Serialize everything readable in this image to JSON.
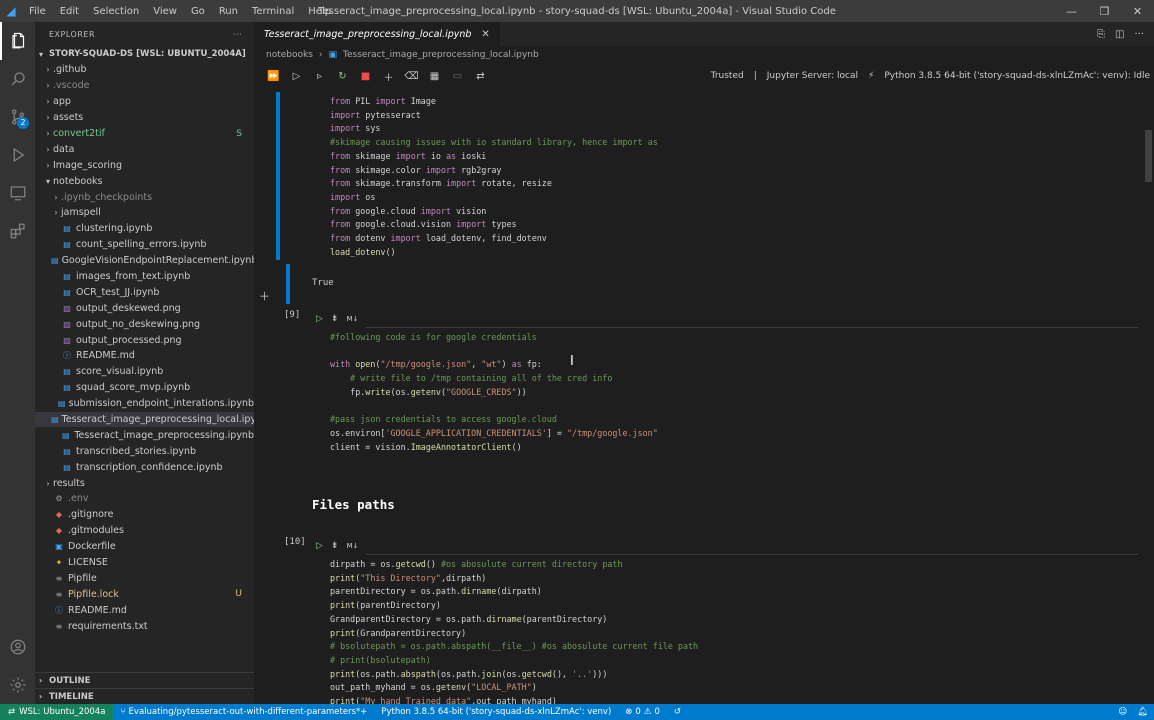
{
  "titlebar": {
    "menu": [
      "File",
      "Edit",
      "Selection",
      "View",
      "Go",
      "Run",
      "Terminal",
      "Help"
    ],
    "title": "Tesseract_image_preprocessing_local.ipynb - story-squad-ds [WSL: Ubuntu_2004a] - Visual Studio Code"
  },
  "activitybar": {
    "source_control_badge": "2"
  },
  "sidebar": {
    "header": "EXPLORER",
    "workspace": "STORY-SQUAD-DS [WSL: UBUNTU_2004A]",
    "items": [
      {
        "label": ".github",
        "type": "folder",
        "depth": 1,
        "color": "#cccccc"
      },
      {
        "label": ".vscode",
        "type": "folder",
        "depth": 1,
        "color": "#8b8b8b"
      },
      {
        "label": "app",
        "type": "folder",
        "depth": 1,
        "color": "#cccccc"
      },
      {
        "label": "assets",
        "type": "folder",
        "depth": 1,
        "color": "#cccccc"
      },
      {
        "label": "convert2tif",
        "type": "folder",
        "depth": 1,
        "color": "#73c991",
        "deco": "S"
      },
      {
        "label": "data",
        "type": "folder",
        "depth": 1,
        "color": "#cccccc"
      },
      {
        "label": "Image_scoring",
        "type": "folder",
        "depth": 1,
        "color": "#cccccc"
      },
      {
        "label": "notebooks",
        "type": "folder-open",
        "depth": 1,
        "color": "#cccccc"
      },
      {
        "label": ".ipynb_checkpoints",
        "type": "folder",
        "depth": 2,
        "color": "#8b8b8b"
      },
      {
        "label": "jamspell",
        "type": "folder",
        "depth": 2,
        "color": "#cccccc"
      },
      {
        "label": "clustering.ipynb",
        "type": "nb",
        "depth": 2,
        "color": "#cccccc"
      },
      {
        "label": "count_spelling_errors.ipynb",
        "type": "nb",
        "depth": 2,
        "color": "#cccccc"
      },
      {
        "label": "GoogleVisionEndpointReplacement.ipynb",
        "type": "nb",
        "depth": 2,
        "color": "#cccccc"
      },
      {
        "label": "images_from_text.ipynb",
        "type": "nb",
        "depth": 2,
        "color": "#cccccc"
      },
      {
        "label": "OCR_test_JJ.ipynb",
        "type": "nb",
        "depth": 2,
        "color": "#cccccc"
      },
      {
        "label": "output_deskewed.png",
        "type": "img",
        "depth": 2,
        "color": "#cccccc"
      },
      {
        "label": "output_no_deskewing.png",
        "type": "img",
        "depth": 2,
        "color": "#cccccc"
      },
      {
        "label": "output_processed.png",
        "type": "img",
        "depth": 2,
        "color": "#cccccc"
      },
      {
        "label": "README.md",
        "type": "md",
        "depth": 2,
        "color": "#cccccc"
      },
      {
        "label": "score_visual.ipynb",
        "type": "nb",
        "depth": 2,
        "color": "#cccccc"
      },
      {
        "label": "squad_score_mvp.ipynb",
        "type": "nb",
        "depth": 2,
        "color": "#cccccc"
      },
      {
        "label": "submission_endpoint_interations.ipynb",
        "type": "nb",
        "depth": 2,
        "color": "#cccccc"
      },
      {
        "label": "Tesseract_image_preprocessing_local.ipynb",
        "type": "nb",
        "depth": 2,
        "color": "#cccccc",
        "selected": true
      },
      {
        "label": "Tesseract_image_preprocessing.ipynb",
        "type": "nb",
        "depth": 2,
        "color": "#cccccc"
      },
      {
        "label": "transcribed_stories.ipynb",
        "type": "nb",
        "depth": 2,
        "color": "#cccccc"
      },
      {
        "label": "transcription_confidence.ipynb",
        "type": "nb",
        "depth": 2,
        "color": "#cccccc"
      },
      {
        "label": "results",
        "type": "folder",
        "depth": 1,
        "color": "#cccccc"
      },
      {
        "label": ".env",
        "type": "gear",
        "depth": 1,
        "color": "#8b8b8b"
      },
      {
        "label": ".gitignore",
        "type": "git",
        "depth": 1,
        "color": "#cccccc"
      },
      {
        "label": ".gitmodules",
        "type": "git",
        "depth": 1,
        "color": "#cccccc"
      },
      {
        "label": "Dockerfile",
        "type": "docker",
        "depth": 1,
        "color": "#cccccc"
      },
      {
        "label": "LICENSE",
        "type": "license",
        "depth": 1,
        "color": "#cccccc"
      },
      {
        "label": "Pipfile",
        "type": "file",
        "depth": 1,
        "color": "#cccccc"
      },
      {
        "label": "Pipfile.lock",
        "type": "file",
        "depth": 1,
        "color": "#e2c08d",
        "deco": "U"
      },
      {
        "label": "README.md",
        "type": "md",
        "depth": 1,
        "color": "#cccccc"
      },
      {
        "label": "requirements.txt",
        "type": "txt",
        "depth": 1,
        "color": "#cccccc"
      }
    ],
    "outline": "OUTLINE",
    "timeline": "TIMELINE"
  },
  "editor": {
    "tab_label": "Tesseract_image_preprocessing_local.ipynb",
    "breadcrumb": [
      "notebooks",
      "Tesseract_image_preprocessing_local.ipynb"
    ],
    "trusted": "Trusted",
    "jupyter_server": "Jupyter Server: local",
    "kernel": "Python 3.8.5 64-bit ('story-squad-ds-xlnLZmAc': venv): Idle"
  },
  "cells": {
    "cell_top_output": "True",
    "cell9_count": "[9]",
    "cell10_count": "[10]",
    "markdown_heading": "Files paths"
  },
  "statusbar": {
    "remote": "WSL: Ubuntu_2004a",
    "task": "Evaluating/pytesseract-out-with-different-parameters*+",
    "interpreter": "Python 3.8.5 64-bit ('story-squad-ds-xlnLZmAc': venv)",
    "errors": "0",
    "warnings": "0"
  }
}
